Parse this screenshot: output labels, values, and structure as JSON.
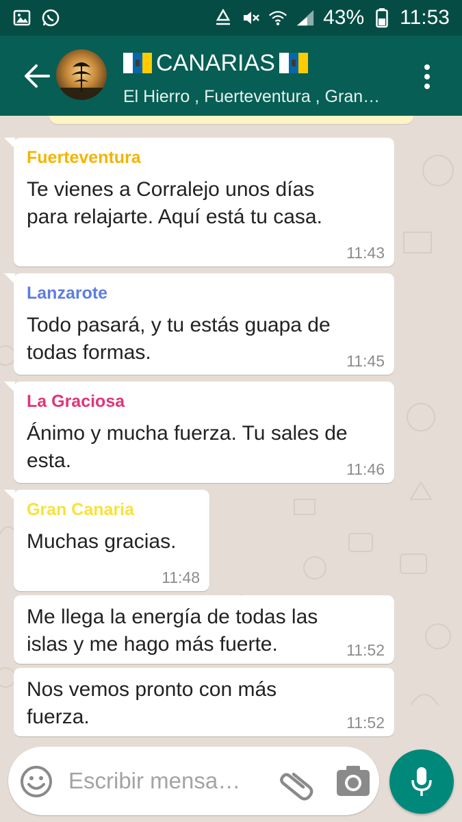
{
  "status_bar": {
    "battery": "43%",
    "time": "11:53"
  },
  "header": {
    "title": "CANARIAS",
    "subtitle": "El Hierro , Fuerteventura , Gran…"
  },
  "messages": [
    {
      "sender": "Fuerteventura",
      "sender_color": "#f4b400",
      "text": "Te vienes a Corralejo unos días para relajarte. Aquí está tu casa.",
      "time": "11:43"
    },
    {
      "sender": "Lanzarote",
      "sender_color": "#5c7ee0",
      "text": "Todo pasará, y tu estás guapa de todas formas.",
      "time": "11:45"
    },
    {
      "sender": "La Graciosa",
      "sender_color": "#e0347a",
      "text": "Ánimo y mucha fuerza. Tu sales de esta.",
      "time": "11:46"
    },
    {
      "sender": "Gran Canaria",
      "sender_color": "#f7e23a",
      "text": "Muchas gracias.",
      "time": "11:48"
    },
    {
      "sender": "",
      "text": "Me llega la energía de todas las islas y me hago más fuerte.",
      "time": "11:52"
    },
    {
      "sender": "",
      "text": "Nos vemos pronto con más fuerza.",
      "time": "11:52"
    }
  ],
  "composer": {
    "placeholder": "Escribir mensa…"
  },
  "colors": {
    "app_bar": "#075e54",
    "status_bar": "#054d44",
    "fab": "#00897b",
    "chat_bg": "#e5ddd5"
  },
  "icons": [
    "gallery-icon",
    "whatsapp-icon",
    "recycle-icon",
    "mute-icon",
    "wifi-icon",
    "signal-icon",
    "battery-icon",
    "back-arrow-icon",
    "canary-flag-icon",
    "more-vert-icon",
    "emoji-icon",
    "attach-icon",
    "camera-icon",
    "mic-icon"
  ]
}
